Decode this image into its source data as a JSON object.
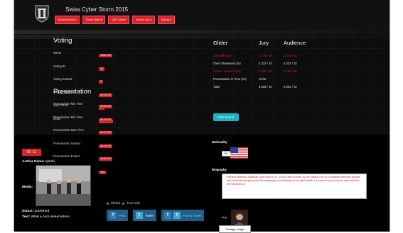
{
  "header": {
    "title": "Swiss Cyber Storm 2015",
    "nav": [
      "Event Room ▾",
      "Event Item ▾",
      "QR Code ▾",
      "What's Up ▾",
      "Voting ▾"
    ]
  },
  "voting": {
    "title": "Voting",
    "fields": [
      {
        "label": "Name",
        "value": "Tone-OH"
      },
      {
        "label": "Voting ID",
        "value": "16"
      },
      {
        "label": "Voting Started",
        "value": "1"
      },
      {
        "label": "Voting Duration",
        "value": "00:00:00"
      },
      {
        "label": "Jury Count",
        "value": "10"
      },
      {
        "label": "Mode",
        "value": "arithmetic"
      }
    ]
  },
  "presentation": {
    "title": "Presentation",
    "fields": [
      {
        "label": "Presentation Min Time",
        "value": "00:00:00"
      },
      {
        "label": "Presentation Min Time",
        "value": "00:00:00"
      },
      {
        "label": "Presentation Max Time",
        "value": "00:27:00"
      },
      {
        "label": "Presentation Started",
        "value": "13:00:00"
      },
      {
        "label": "Presentation Ended",
        "value": "13:00:00"
      },
      {
        "label": "Presentation was in Time",
        "value": "Yes"
      }
    ]
  },
  "results": {
    "headers": [
      "Glider",
      "Jury",
      "Audience"
    ],
    "rows": [
      {
        "label": "Top Slide (5x)",
        "jury": "5.778 / 10",
        "audience": "5.778 / 10",
        "red": true
      },
      {
        "label": "Clear Statement (3x)",
        "jury": "4.222 / 10",
        "audience": "4.222 / 10",
        "red": false
      },
      {
        "label": "Lesson Learned (5x)",
        "jury": "5.222 / 10",
        "audience": "5.222 / 10",
        "red": true
      },
      {
        "label": "Presentation in Time (x1)",
        "jury": "10/10",
        "audience": "-",
        "red": false
      },
      {
        "label": "Total",
        "jury": "5.698 / 10",
        "audience": "4.981 / 10",
        "red": false
      }
    ],
    "csv_label": "CSV Export"
  },
  "item": {
    "id_label": "ID: 11",
    "author_label": "Author Name:",
    "author_value": "tiptobi",
    "media_label": "Media:",
    "status_label": "Status:",
    "status_value": "published",
    "text_label": "Text:",
    "text_value": "What a cool presentation!",
    "media_options": [
      "Media",
      "Text only"
    ],
    "share": {
      "post": "Post",
      "tweet": "Tweet",
      "post_tweet": "Post & Tweet"
    }
  },
  "profile": {
    "nationality_label": "Nationality",
    "country_value": "US",
    "biography_label": "Biography",
    "biography_text": "Richard Matthew Stallman (born March 16, 1953), often known by his initials, rms, is a software freedom activist and computer programmer. He campaigns for software to be distributed in a manner such that its users receive the freedoms to",
    "img_label": "Img",
    "change_image_label": "Change image"
  },
  "colors": {
    "accent_red": "#d8232a",
    "accent_teal": "#19b3c6",
    "background": "#000000"
  }
}
